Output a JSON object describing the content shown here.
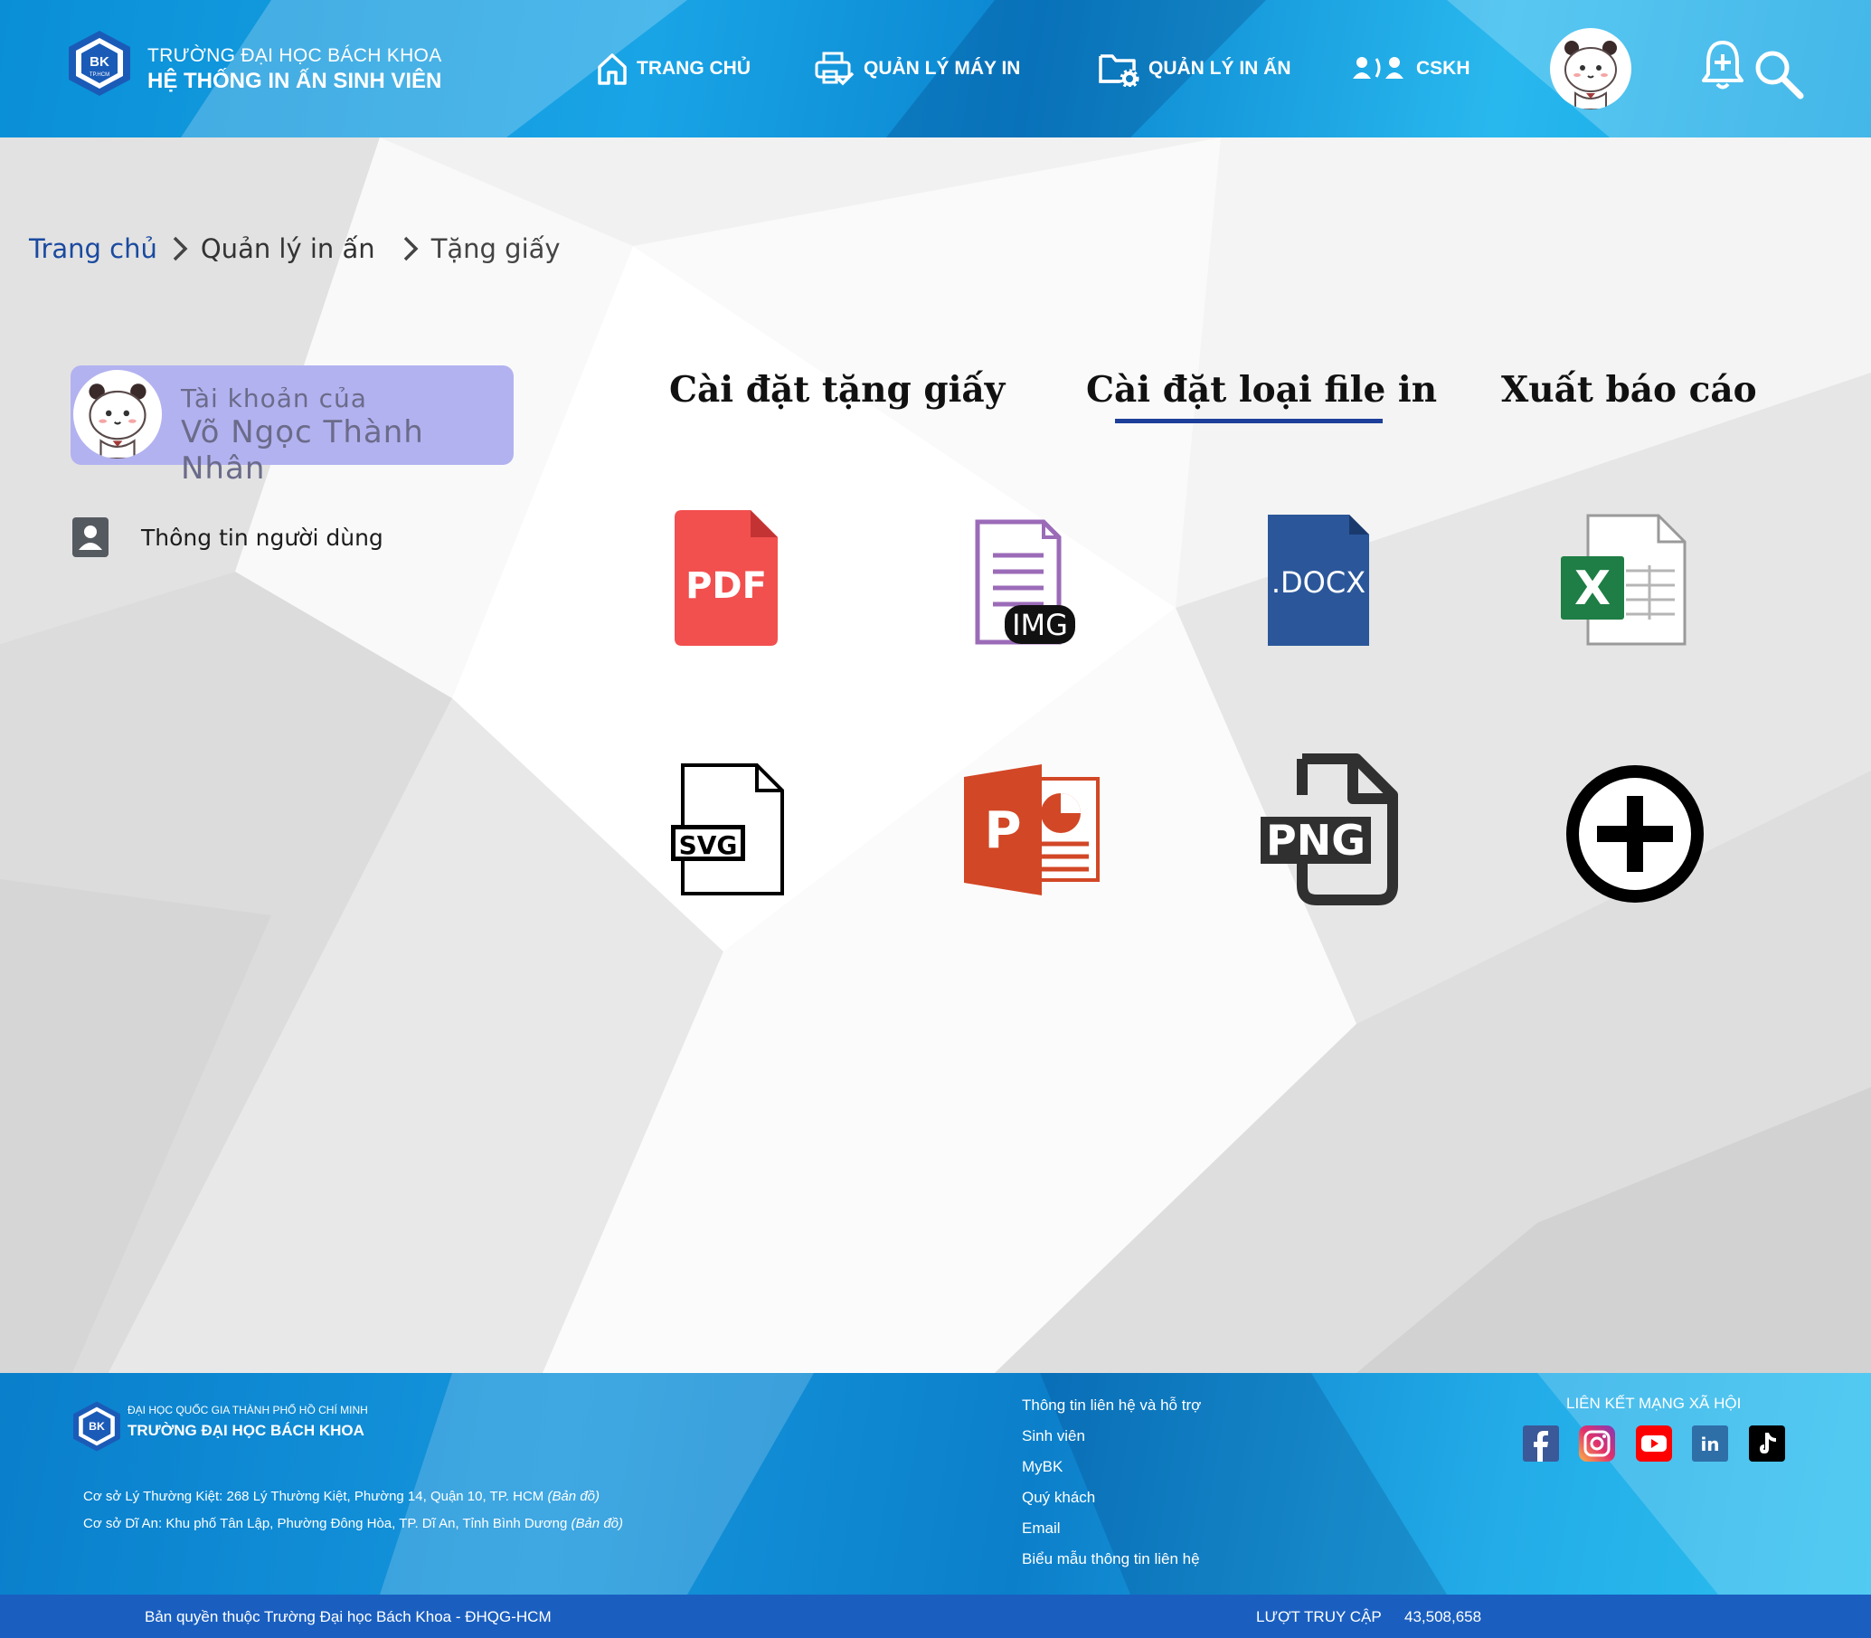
{
  "header": {
    "school_name": "TRƯỜNG ĐẠI HỌC BÁCH KHOA",
    "system_name": "HỆ THỐNG IN ẤN SINH VIÊN",
    "logo_text": "BK",
    "logo_subtext": "TP.HCM",
    "nav": [
      {
        "label": "TRANG CHỦ",
        "icon": "home-icon"
      },
      {
        "label": "QUẢN LÝ MÁY IN",
        "icon": "printer-check-icon"
      },
      {
        "label": "QUẢN LÝ IN ẤN",
        "icon": "folder-gear-icon"
      },
      {
        "label": "CSKH",
        "icon": "customer-support-icon"
      }
    ]
  },
  "breadcrumb": {
    "items": [
      "Trang chủ",
      "Quản lý in ấn",
      "Tặng giấy"
    ]
  },
  "sidebar": {
    "account_label": "Tài khoản của",
    "account_name": "Võ Ngọc Thành Nhân",
    "items": [
      {
        "label": "Thông tin người dùng",
        "icon": "user-badge-icon"
      }
    ]
  },
  "tabs": {
    "items": [
      "Cài đặt tặng giấy",
      "Cài đặt loại file in",
      "Xuất báo cáo"
    ],
    "active_index": 1
  },
  "file_types": {
    "pdf": "PDF",
    "img": "IMG",
    "docx": ".DOCX",
    "xlsx": "X",
    "svg": "SVG",
    "ppt": "P",
    "png": "PNG"
  },
  "footer": {
    "university_parent": "ĐẠI HỌC QUỐC GIA THÀNH PHỐ HỒ CHÍ MINH",
    "university_name": "TRƯỜNG ĐẠI HỌC BÁCH KHOA",
    "address_1": "Cơ sở Lý Thường Kiệt: 268 Lý Thường Kiệt, Phường 14, Quận 10, TP. HCM",
    "address_2": "Cơ sở Dĩ An: Khu phố Tân Lập, Phường Đông Hòa, TP. Dĩ An, Tỉnh Bình Dương",
    "map_link": "(Bản đồ)",
    "links": [
      "Thông tin liên hệ và hỗ trợ",
      "Sinh viên",
      "MyBK",
      "Quý khách",
      "Email",
      "Biểu mẫu thông tin liên hệ"
    ],
    "social_title": "LIÊN KẾT MẠNG XÃ HỘI",
    "social": [
      "facebook-icon",
      "instagram-icon",
      "youtube-icon",
      "linkedin-icon",
      "tiktok-icon"
    ],
    "copyright": "Bản quyền thuộc Trường Đại học Bách Khoa - ĐHQG-HCM",
    "visits_label": "LƯỢT TRUY CẬP",
    "visits_count": "43,508,658"
  },
  "colors": {
    "header_blue": "#0a8fd6",
    "account_card": "#b3b2f0",
    "active_tab_underline": "#1d3f9a",
    "pdf_red": "#f24f4f",
    "docx_blue": "#2b579a",
    "xlsx_green": "#1e7e45",
    "ppt_orange": "#d24726",
    "img_purple": "#9b6bb8"
  }
}
